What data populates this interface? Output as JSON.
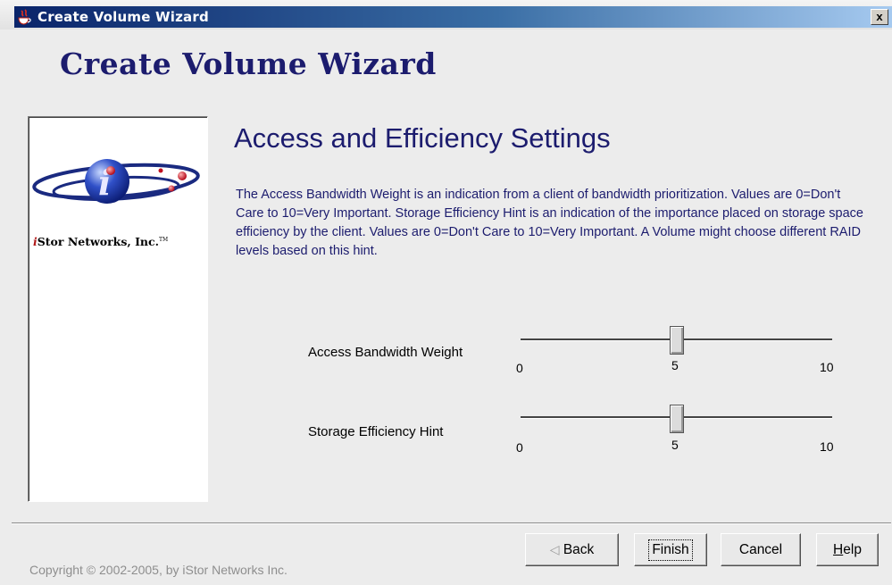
{
  "window": {
    "title": "Create Volume Wizard",
    "close_label": "x"
  },
  "wizard": {
    "heading": "Create Volume Wizard"
  },
  "logo": {
    "company_prefix": "i",
    "company_rest": "Stor Networks, Inc.",
    "trademark": "TM"
  },
  "section": {
    "title": "Access and Efficiency Settings",
    "description": "The Access Bandwidth Weight is an indication from a client of bandwidth prioritization. Values are 0=Don't Care to 10=Very Important. Storage Efficiency Hint is an indication of the importance placed on storage space efficiency by the client. Values are 0=Don't Care to 10=Very Important. A Volume might choose different RAID levels based on this hint."
  },
  "sliders": {
    "bandwidth": {
      "label": "Access Bandwidth Weight",
      "min": "0",
      "mid": "5",
      "max": "10",
      "value": 5
    },
    "efficiency": {
      "label": "Storage Efficiency Hint",
      "min": "0",
      "mid": "5",
      "max": "10",
      "value": 5
    }
  },
  "buttons": {
    "back": "Back",
    "finish": "Finish",
    "cancel": "Cancel",
    "help_prefix": "H",
    "help_rest": "elp"
  },
  "footer": {
    "copyright": "Copyright © 2002-2005, by iStor Networks Inc."
  }
}
